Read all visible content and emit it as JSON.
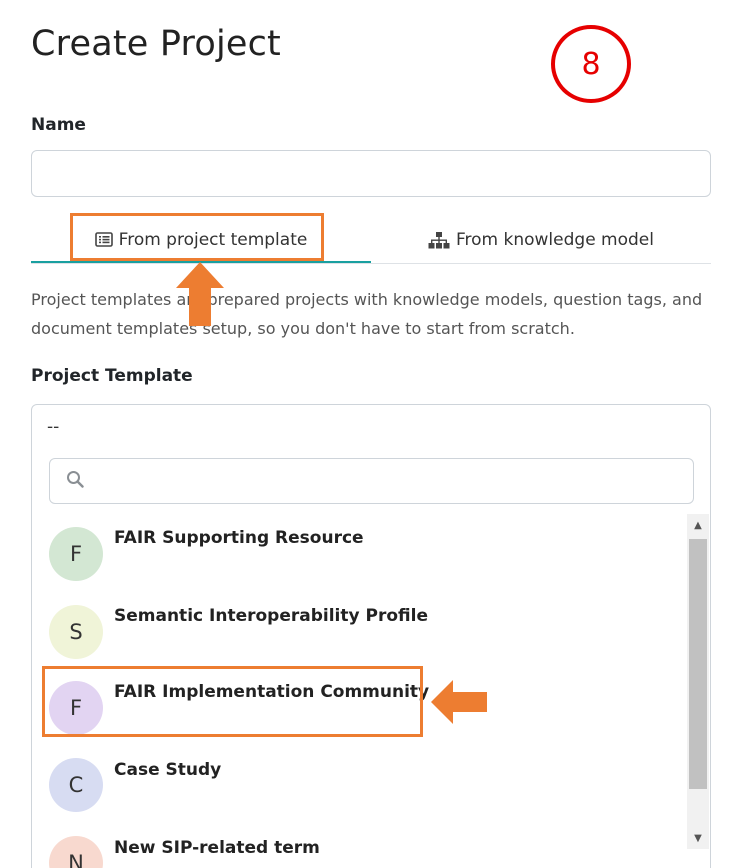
{
  "page": {
    "title": "Create Project",
    "step_number": "8"
  },
  "form": {
    "name_label": "Name",
    "name_value": "",
    "tabs": [
      {
        "label": "From project template",
        "icon": "list-icon",
        "active": true
      },
      {
        "label": "From knowledge model",
        "icon": "sitemap-icon",
        "active": false
      }
    ],
    "description": "Project templates are prepared projects with knowledge models, question tags, and document templates setup, so you don't have to start from scratch.",
    "template_label": "Project Template",
    "template_selected": "--",
    "search_value": "",
    "options": [
      {
        "initial": "F",
        "label": "FAIR Supporting Resource",
        "avatar_color": "#d3e7d3"
      },
      {
        "initial": "S",
        "label": "Semantic Interoperability Profile",
        "avatar_color": "#f0f4d8"
      },
      {
        "initial": "F",
        "label": "FAIR Implementation Community",
        "avatar_color": "#e2d4f2"
      },
      {
        "initial": "C",
        "label": "Case Study",
        "avatar_color": "#d7dcf2"
      },
      {
        "initial": "N",
        "label": "New SIP-related term",
        "avatar_color": "#f8d9cf"
      }
    ]
  },
  "annotations": {
    "highlight_color": "#ed7d31",
    "step_circle_color": "#e60000"
  }
}
